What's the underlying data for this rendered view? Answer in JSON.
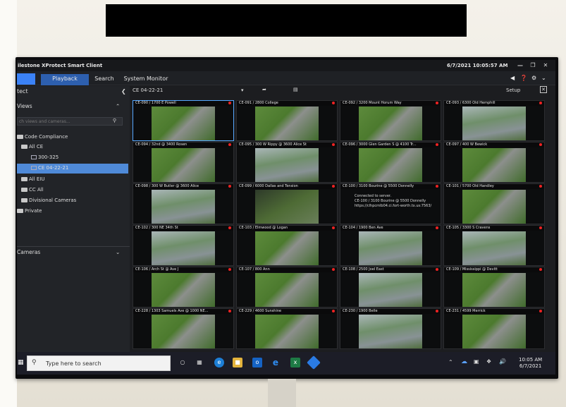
{
  "app": {
    "title": "Milestone XProtect Smart Client",
    "title_visible": "ilestone XProtect Smart Client",
    "clock": "6/7/2021 10:05:57 AM"
  },
  "tabs": [
    {
      "label": ""
    },
    {
      "label": "Playback"
    },
    {
      "label": "Search"
    },
    {
      "label": "System Monitor"
    }
  ],
  "left_pane": {
    "header": "tect",
    "views_label": "Views",
    "search_placeholder": "ch views and cameras...",
    "tree": [
      {
        "label": "Code Compliance"
      },
      {
        "label": "All CE"
      },
      {
        "label": "300-325"
      },
      {
        "label": "CE 04-22-21"
      },
      {
        "label": "All EIU"
      },
      {
        "label": "CC All"
      },
      {
        "label": "Divisional Cameras"
      },
      {
        "label": "Private"
      }
    ],
    "cameras_label": "Cameras"
  },
  "viewbar": {
    "view_name": "CE 04-22-21",
    "setup_label": "Setup"
  },
  "cameras": [
    {
      "label": "CE-090 / 1700 E Powell",
      "img": "road"
    },
    {
      "label": "CE-091 / 2800 College",
      "img": "road"
    },
    {
      "label": "CE-092 / 3200 Mount Horum Way",
      "img": "road"
    },
    {
      "label": "CE-093 / 6300 Old Hemphill",
      "img": "water"
    },
    {
      "label": "CE-094 / 32nd @ 3400 Rosen",
      "img": "road"
    },
    {
      "label": "CE-095 / 300 W Rippy @ 3600 Alice St",
      "img": "water"
    },
    {
      "label": "CE-096 / 3000 Glen Garden S @ 4100 Tr...",
      "img": "road"
    },
    {
      "label": "CE-097 / 400 W Bewick",
      "img": "road"
    },
    {
      "label": "CE-098 / 300 W Butler @ 3600 Alice",
      "img": "water"
    },
    {
      "label": "CE-099 / 6000 Dallas and Tension",
      "img": "dark"
    },
    {
      "label": "CE-100 / 3100 Bourine @ 5500 Donnelly",
      "img": "none",
      "msg1": "Connected to server.",
      "msg2": "CE-100 / 3100 Bourine @ 5500 Donnelly",
      "msg3": "https://clhpcmlb04.ci.fort-worth.tx.us:7563/"
    },
    {
      "label": "CE-101 / 5700 Old Handley",
      "img": "road"
    },
    {
      "label": "CE-102 / 300 NE 34th St",
      "img": "water"
    },
    {
      "label": "CE-103 / Elmwood @ Logan",
      "img": "road"
    },
    {
      "label": "CE-104 / 1900 Ben Ave",
      "img": "water"
    },
    {
      "label": "CE-105 / 3300 S Cravens",
      "img": "water"
    },
    {
      "label": "CE-106 / Arch St @ Ave J",
      "img": "road"
    },
    {
      "label": "CE-107 / 800 Ann",
      "img": "road"
    },
    {
      "label": "CE-108 / 2500 Joel East",
      "img": "water"
    },
    {
      "label": "CE-109 / Mississippi @ Devitt",
      "img": "road"
    },
    {
      "label": "CE-228 / 1303 Samuels Ave @ 1000 NE...",
      "img": "road"
    },
    {
      "label": "CE-229 / 4600 Sunshine",
      "img": "road"
    },
    {
      "label": "CE-230 / 1900 Belle",
      "img": "water"
    },
    {
      "label": "CE-231 / 4599 Merrick",
      "img": "road"
    }
  ],
  "taskbar": {
    "search_placeholder": "Type here to search",
    "time": "10:05 AM",
    "date": "6/7/2021"
  }
}
